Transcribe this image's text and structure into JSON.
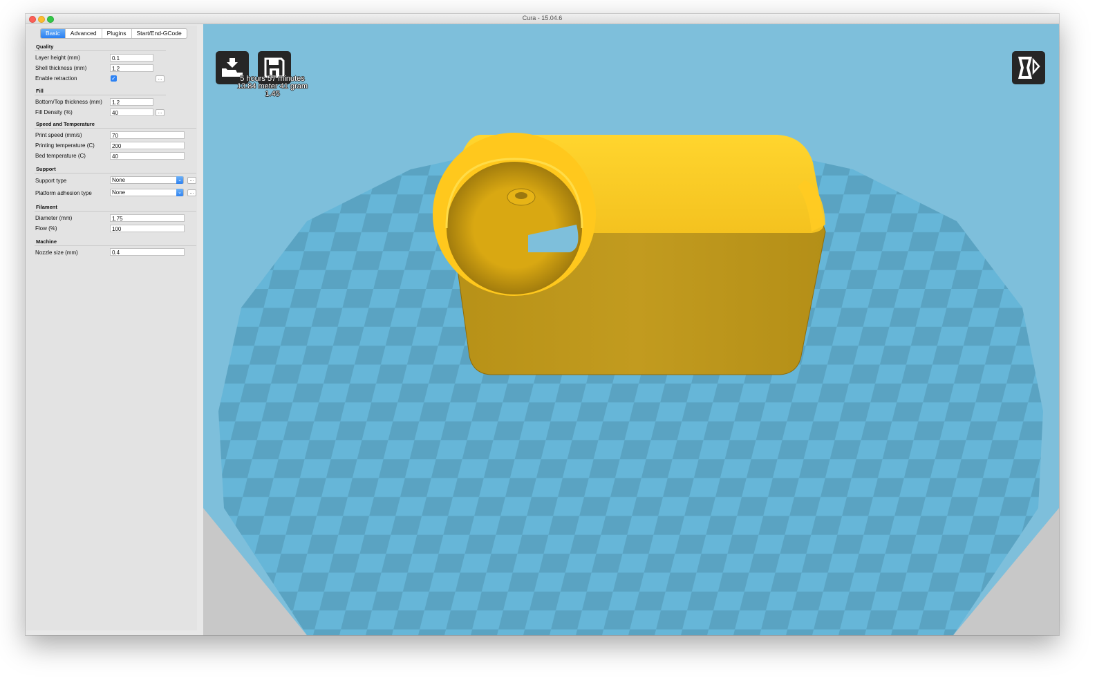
{
  "window": {
    "title": "Cura - 15.04.6"
  },
  "tabs": [
    {
      "label": "Basic",
      "active": true
    },
    {
      "label": "Advanced",
      "active": false
    },
    {
      "label": "Plugins",
      "active": false
    },
    {
      "label": "Start/End-GCode",
      "active": false
    }
  ],
  "quality": {
    "heading": "Quality",
    "layer_height": {
      "label": "Layer height (mm)",
      "value": "0.1"
    },
    "shell_thickness": {
      "label": "Shell thickness (mm)",
      "value": "1.2"
    },
    "enable_retraction": {
      "label": "Enable retraction",
      "checked": true
    }
  },
  "fill": {
    "heading": "Fill",
    "bottom_top": {
      "label": "Bottom/Top thickness (mm)",
      "value": "1.2"
    },
    "density": {
      "label": "Fill Density (%)",
      "value": "40"
    }
  },
  "speed": {
    "heading": "Speed and Temperature",
    "print_speed": {
      "label": "Print speed (mm/s)",
      "value": "70"
    },
    "print_temp": {
      "label": "Printing temperature (C)",
      "value": "200"
    },
    "bed_temp": {
      "label": "Bed temperature (C)",
      "value": "40"
    }
  },
  "support": {
    "heading": "Support",
    "support_type": {
      "label": "Support type",
      "value": "None"
    },
    "adhesion": {
      "label": "Platform adhesion type",
      "value": "None"
    }
  },
  "filament": {
    "heading": "Filament",
    "diameter": {
      "label": "Diameter (mm)",
      "value": "1.75"
    },
    "flow": {
      "label": "Flow (%)",
      "value": "100"
    }
  },
  "machine": {
    "heading": "Machine",
    "nozzle": {
      "label": "Nozzle size (mm)",
      "value": "0.4"
    }
  },
  "ellipsis_label": "...",
  "viewport": {
    "stats": {
      "time": "5 hours 57 minutes",
      "material": "13.84 meter 41 gram",
      "cost": "1.45"
    },
    "icons": [
      "load-model-icon",
      "save-toolpath-icon",
      "view-mode-icon"
    ],
    "colors": {
      "background": "#7ebfdb",
      "platform_light": "#66b6d8",
      "platform_dark": "#5aa3c2",
      "model": "#c09a1e",
      "model_highlight": "#ffcb22"
    }
  }
}
